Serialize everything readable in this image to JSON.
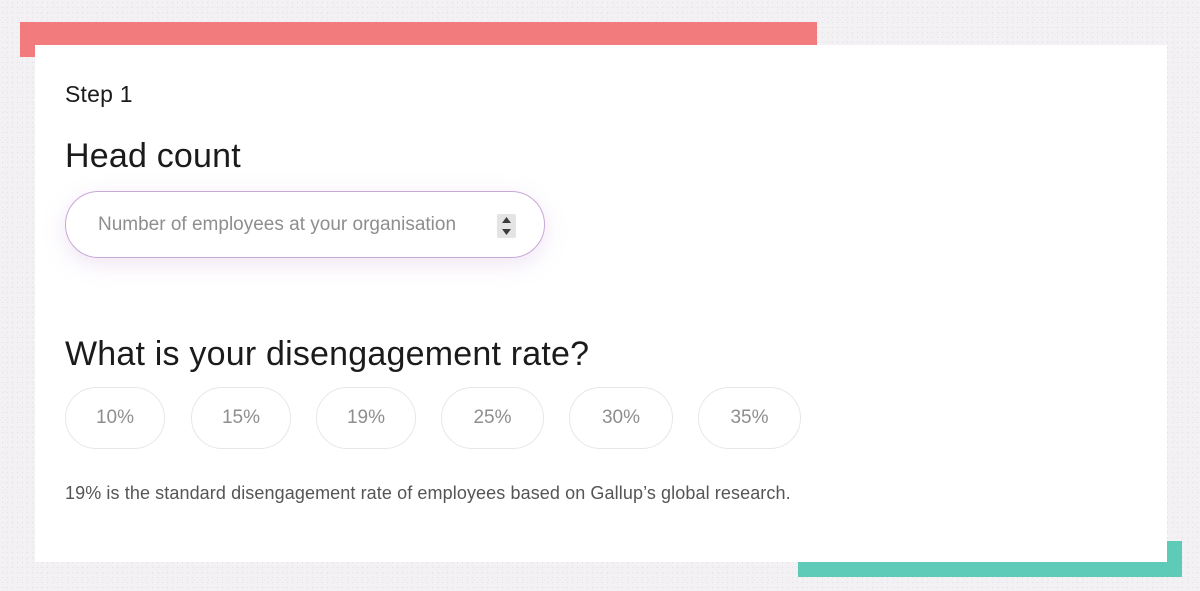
{
  "step": {
    "label": "Step 1"
  },
  "headcount": {
    "title": "Head count",
    "placeholder": "Number of employees at your organisation",
    "value": ""
  },
  "disengagement": {
    "title": "What is your disengagement rate?",
    "options": [
      "10%",
      "15%",
      "19%",
      "25%",
      "30%",
      "35%"
    ],
    "helper": "19% is the standard disengagement rate of employees based on Gallup’s global research."
  },
  "colors": {
    "accent_top": "#f27b7d",
    "accent_bottom": "#5ecbb9",
    "input_border": "#c9a8d8",
    "pill_text": "#8e8e8e",
    "heading": "#1b1b1b"
  },
  "icons": {
    "spinner_up": "triangle-up-icon",
    "spinner_down": "triangle-down-icon"
  }
}
